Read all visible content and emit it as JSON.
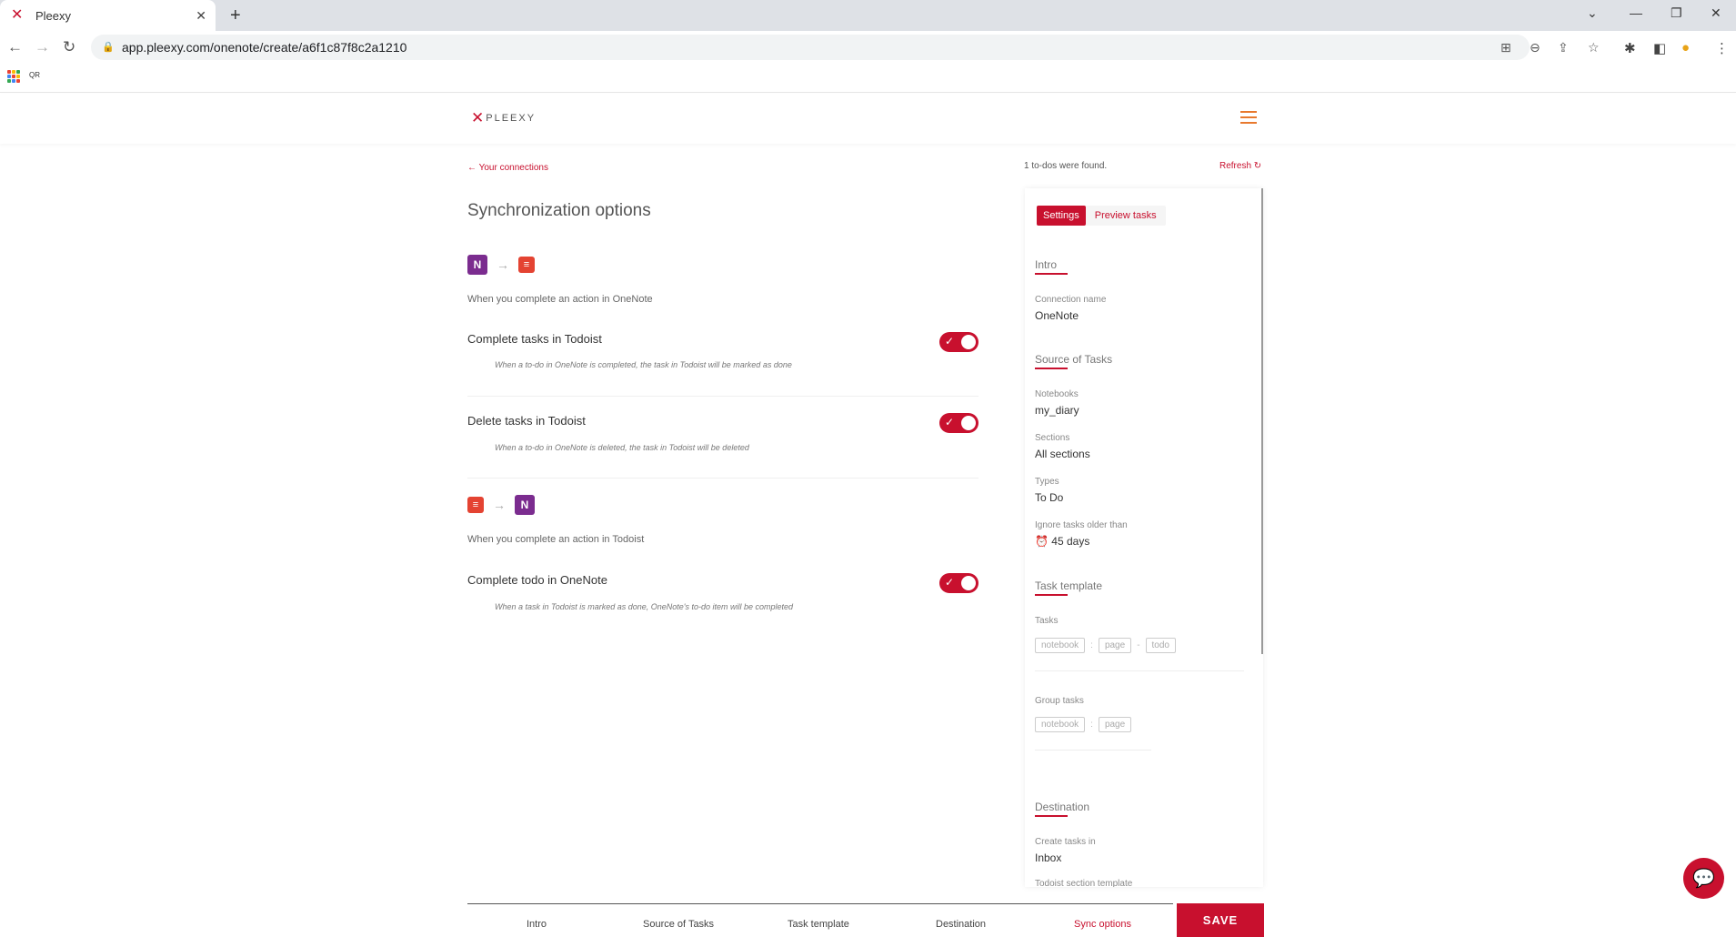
{
  "browser": {
    "tab_title": "Pleexy",
    "url": "app.pleexy.com/onenote/create/a6f1c87f8c2a1210",
    "bookmark_label": "QR"
  },
  "header": {
    "logo_text": "PLEEXY"
  },
  "left": {
    "back_link": "Your connections",
    "title": "Synchronization options",
    "onenote_section_hint": "When you complete an action in OneNote",
    "todoist_section_hint": "When you complete an action in Todoist",
    "options": [
      {
        "label": "Complete tasks in Todoist",
        "desc": "When a to-do in OneNote is completed, the task in Todoist will be marked as done",
        "enabled": true
      },
      {
        "label": "Delete tasks in Todoist",
        "desc": "When a to-do in OneNote is deleted, the task in Todoist will be deleted",
        "enabled": true
      },
      {
        "label": "Complete todo in OneNote",
        "desc": "When a task in Todoist is marked as done, OneNote's to-do item will be completed",
        "enabled": true
      }
    ]
  },
  "right": {
    "found_text": "1 to-dos were found.",
    "refresh_label": "Refresh",
    "tabs": [
      "Settings",
      "Preview tasks"
    ],
    "intro_head": "Intro",
    "connection_name_label": "Connection name",
    "connection_name_value": "OneNote",
    "source_head": "Source of Tasks",
    "notebooks_label": "Notebooks",
    "notebooks_value": "my_diary",
    "sections_label": "Sections",
    "sections_value": "All sections",
    "types_label": "Types",
    "types_value": "To Do",
    "ignore_label": "Ignore tasks older than",
    "ignore_value": "45 days",
    "template_head": "Task template",
    "tasks_label": "Tasks",
    "tasks_chips": [
      "notebook",
      "page",
      "todo"
    ],
    "tasks_seps": [
      ":",
      "-"
    ],
    "group_label": "Group tasks",
    "group_chips": [
      "notebook",
      "page"
    ],
    "group_sep": ":",
    "destination_head": "Destination",
    "create_in_label": "Create tasks in",
    "create_in_value": "Inbox",
    "section_template_label": "Todoist section template"
  },
  "steps": [
    "Intro",
    "Source of Tasks",
    "Task template",
    "Destination",
    "Sync options"
  ],
  "active_step": "Sync options",
  "save_label": "SAVE",
  "colors": {
    "accent": "#c8102e",
    "onenote": "#7b2c8f",
    "todoist": "#e44332",
    "menu": "#e8792e"
  }
}
